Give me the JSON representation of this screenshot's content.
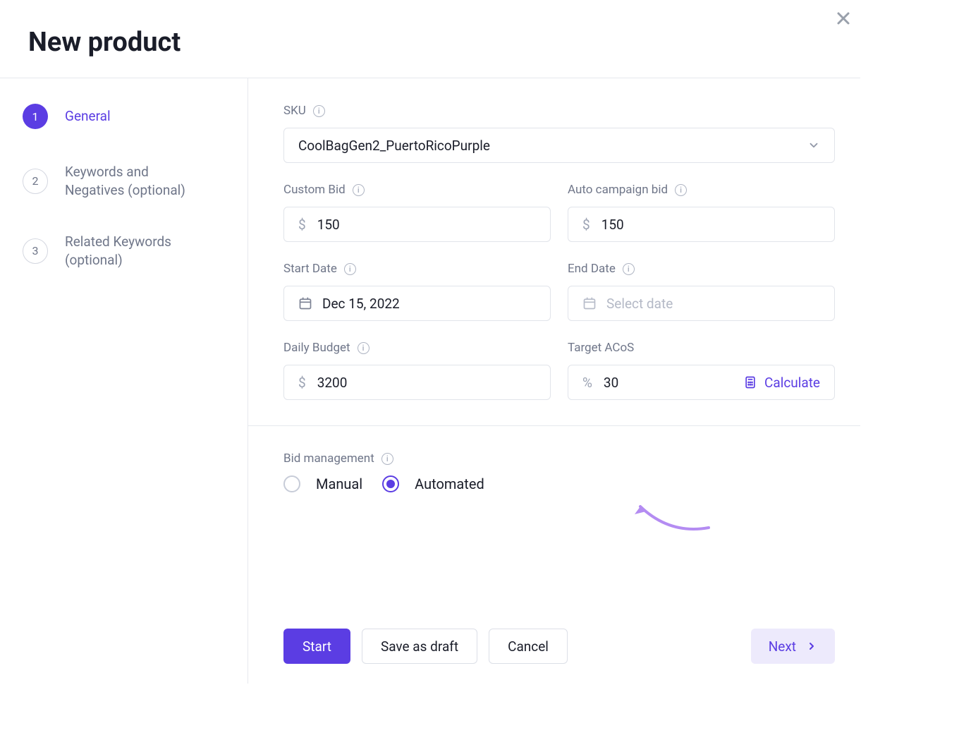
{
  "header": {
    "title": "New product"
  },
  "sidebar": {
    "steps": [
      {
        "num": "1",
        "label": "General",
        "active": true
      },
      {
        "num": "2",
        "label": "Keywords and Negatives (optional)",
        "active": false
      },
      {
        "num": "3",
        "label": "Related Keywords (optional)",
        "active": false
      }
    ]
  },
  "form": {
    "sku": {
      "label": "SKU",
      "value": "CoolBagGen2_PuertoRicoPurple"
    },
    "custom_bid": {
      "label": "Custom Bid",
      "prefix": "$",
      "value": "150"
    },
    "auto_bid": {
      "label": "Auto campaign bid",
      "prefix": "$",
      "value": "150"
    },
    "start_date": {
      "label": "Start Date",
      "value": "Dec 15, 2022"
    },
    "end_date": {
      "label": "End Date",
      "placeholder": "Select date"
    },
    "daily_budget": {
      "label": "Daily Budget",
      "prefix": "$",
      "value": "3200"
    },
    "target_acos": {
      "label": "Target ACoS",
      "prefix": "%",
      "value": "30",
      "calc": "Calculate"
    },
    "bid_mgmt": {
      "label": "Bid management",
      "manual": "Manual",
      "automated": "Automated",
      "selected": "automated"
    }
  },
  "footer": {
    "start": "Start",
    "save_draft": "Save as draft",
    "cancel": "Cancel",
    "next": "Next"
  }
}
